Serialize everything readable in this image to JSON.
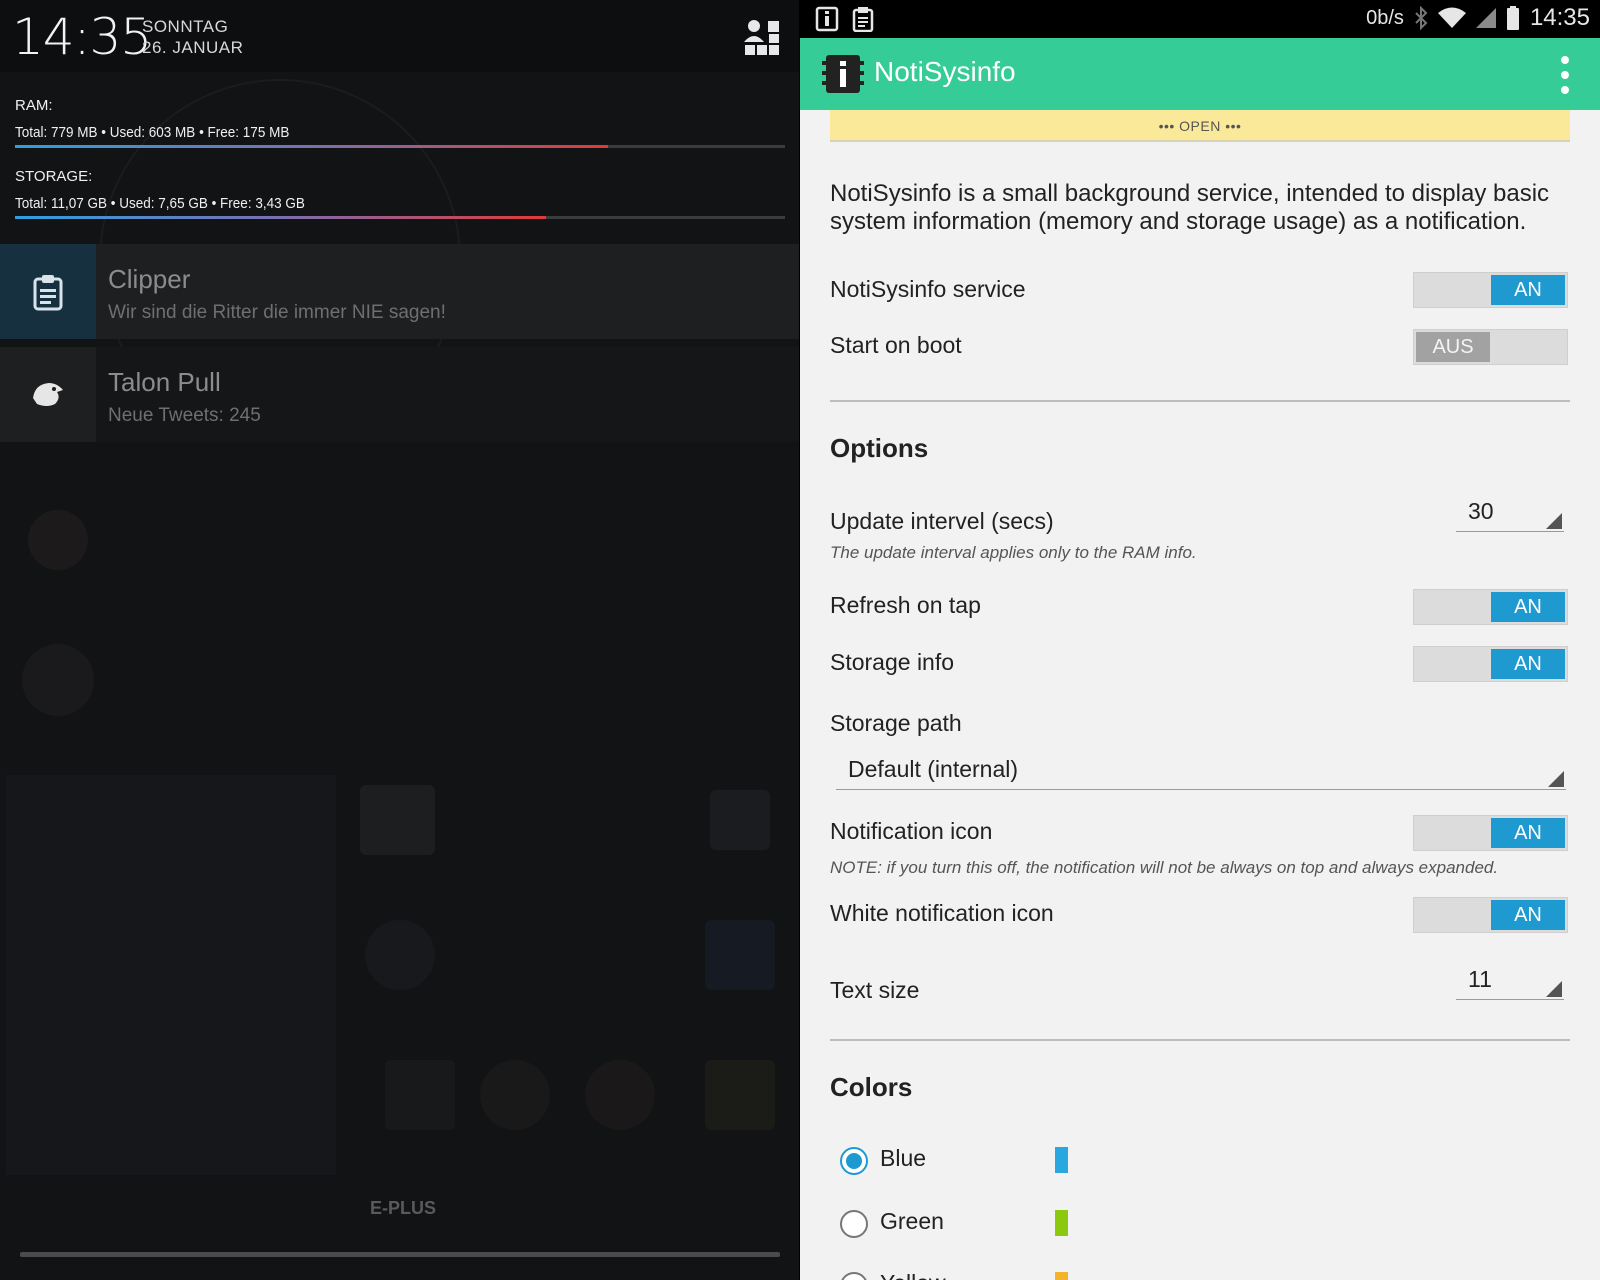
{
  "shade": {
    "time": "14:35",
    "day": "SONNTAG",
    "date": "26. JANUAR",
    "ram": {
      "label": "RAM:",
      "values": "Total: 779 MB  •  Used: 603 MB  •  Free: 175 MB",
      "used_fraction": 0.77
    },
    "storage": {
      "label": "STORAGE:",
      "values": "Total: 11,07 GB  •  Used: 7,65 GB  •  Free: 3,43 GB",
      "used_fraction": 0.69
    },
    "notifications": [
      {
        "icon": "clipboard-icon",
        "title": "Clipper",
        "text": "Wir sind die Ritter die immer NIE sagen!"
      },
      {
        "icon": "talon-bird-icon",
        "title": "Talon Pull",
        "text": "Neue Tweets: 245"
      }
    ],
    "carrier": "E-PLUS"
  },
  "statusbar": {
    "net_speed": "0b/s",
    "time": "14:35",
    "icons": [
      "notisysinfo-icon",
      "clipboard-icon",
      "bluetooth-icon",
      "wifi-icon",
      "signal-icon",
      "battery-icon"
    ]
  },
  "app": {
    "title": "NotiSysinfo",
    "accent": "#35cc97",
    "open_banner": "••• OPEN •••",
    "description": "NotiSysinfo is a small background service, intended to display basic system information (memory and storage usage) as a notification.",
    "settings": {
      "service": {
        "label": "NotiSysinfo service",
        "state": "AN"
      },
      "boot": {
        "label": "Start on boot",
        "state": "AUS"
      }
    },
    "options": {
      "title": "Options",
      "update_interval": {
        "label": "Update intervel (secs)",
        "note": "The update interval applies only to the RAM info.",
        "value": "30"
      },
      "refresh_on_tap": {
        "label": "Refresh on tap",
        "state": "AN"
      },
      "storage_info": {
        "label": "Storage info",
        "state": "AN"
      },
      "storage_path": {
        "label": "Storage path",
        "value": "Default (internal)"
      },
      "notification_icon": {
        "label": "Notification icon",
        "state": "AN",
        "note": "NOTE: if you turn this off, the notification will not be always on top and always expanded."
      },
      "white_icon": {
        "label": "White notification icon",
        "state": "AN"
      },
      "text_size": {
        "label": "Text size",
        "value": "11"
      }
    },
    "colors": {
      "title": "Colors",
      "items": [
        {
          "label": "Blue",
          "color": "#29a8e0",
          "selected": true
        },
        {
          "label": "Green",
          "color": "#8cc90e",
          "selected": false
        },
        {
          "label": "Yellow",
          "color": "#f4b42a",
          "selected": false
        }
      ]
    }
  }
}
